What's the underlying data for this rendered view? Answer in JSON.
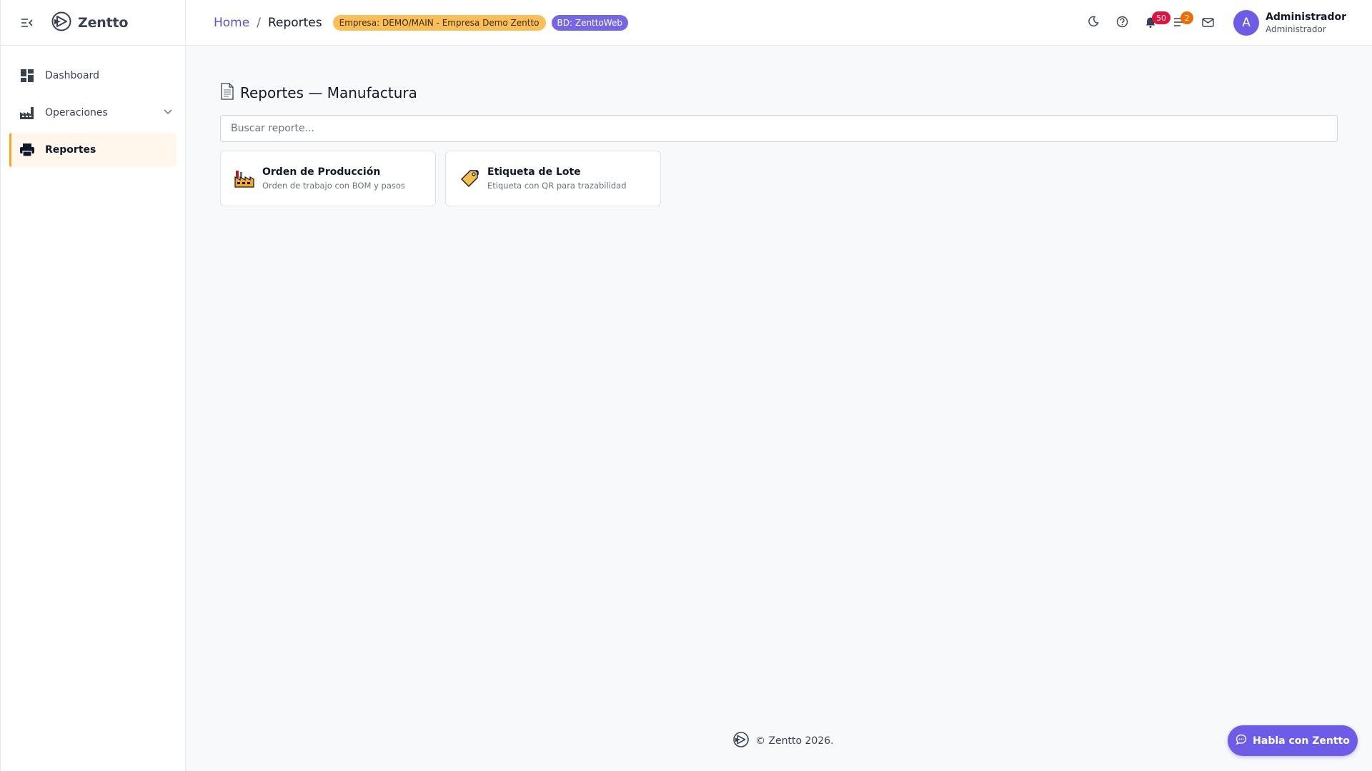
{
  "app": {
    "brand": "Zentto"
  },
  "sidebar": {
    "items": [
      {
        "label": "Dashboard",
        "icon": "dashboard-icon"
      },
      {
        "label": "Operaciones",
        "icon": "factory-icon"
      },
      {
        "label": "Reportes",
        "icon": "printer-icon"
      }
    ],
    "active": "Reportes"
  },
  "header": {
    "breadcrumb": {
      "home": "Home",
      "separator": "/",
      "current": "Reportes"
    },
    "empresa_badge": "Empresa: DEMO/MAIN - Empresa Demo Zentto",
    "bd_badge": "BD: ZenttoWeb",
    "notifications_count": "50",
    "tasks_count": "2",
    "user": {
      "name": "Administrador",
      "role": "Administrador",
      "initial": "A"
    }
  },
  "main": {
    "title": "Reportes — Manufactura",
    "search": {
      "placeholder": "Buscar reporte...",
      "value": ""
    },
    "cards": [
      {
        "title": "Orden de Producción",
        "description": "Orden de trabajo con BOM y pasos",
        "icon": "factory-icon"
      },
      {
        "title": "Etiqueta de Lote",
        "description": "Etiqueta con QR para trazabilidad",
        "icon": "label-tag-icon"
      }
    ]
  },
  "footer": {
    "text": "© Zentto 2026."
  },
  "chat": {
    "label": "Habla con Zentto"
  },
  "colors": {
    "accent": "#6c5ce7",
    "active_indicator": "#f5a623",
    "empresa_badge": "#fbbf57",
    "bd_badge": "#7566e8",
    "notification_badge": "#e3123e",
    "tasks_badge": "#ef6c00"
  }
}
